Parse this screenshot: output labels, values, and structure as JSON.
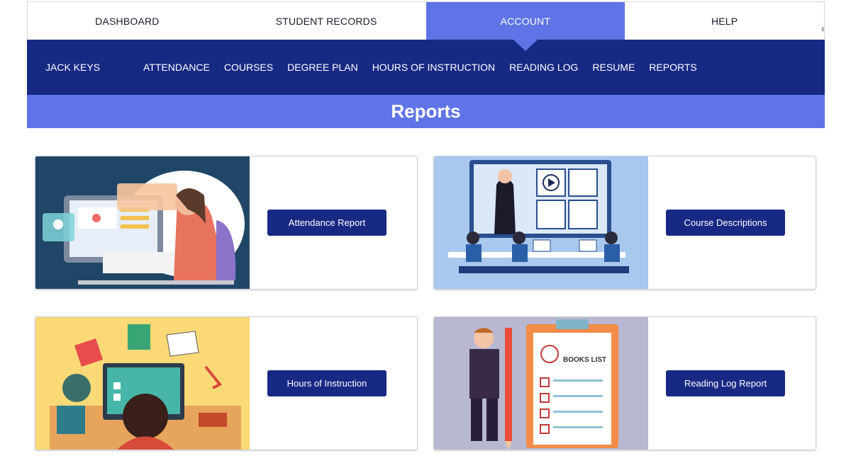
{
  "top_tabs": [
    {
      "label": "DASHBOARD",
      "active": false
    },
    {
      "label": "STUDENT RECORDS",
      "active": false
    },
    {
      "label": "ACCOUNT",
      "active": true
    },
    {
      "label": "HELP",
      "active": false
    }
  ],
  "subnav": {
    "user_name": "JACK KEYS",
    "links": [
      "ATTENDANCE",
      "COURSES",
      "DEGREE PLAN",
      "HOURS OF INSTRUCTION",
      "READING LOG",
      "RESUME",
      "REPORTS"
    ]
  },
  "banner": {
    "title": "Reports"
  },
  "cards": [
    {
      "button_label": "Attendance Report",
      "illustration": "online-learning-illustration"
    },
    {
      "button_label": "Course Descriptions",
      "illustration": "classroom-presentation-illustration"
    },
    {
      "button_label": "Hours of Instruction",
      "illustration": "student-at-computer-illustration"
    },
    {
      "button_label": "Reading Log Report",
      "illustration": "books-list-clipboard-illustration"
    }
  ],
  "books_list_heading": "BOOKS LIST",
  "colors": {
    "navy": "#182984",
    "accent": "#5f74e6",
    "white": "#ffffff"
  }
}
